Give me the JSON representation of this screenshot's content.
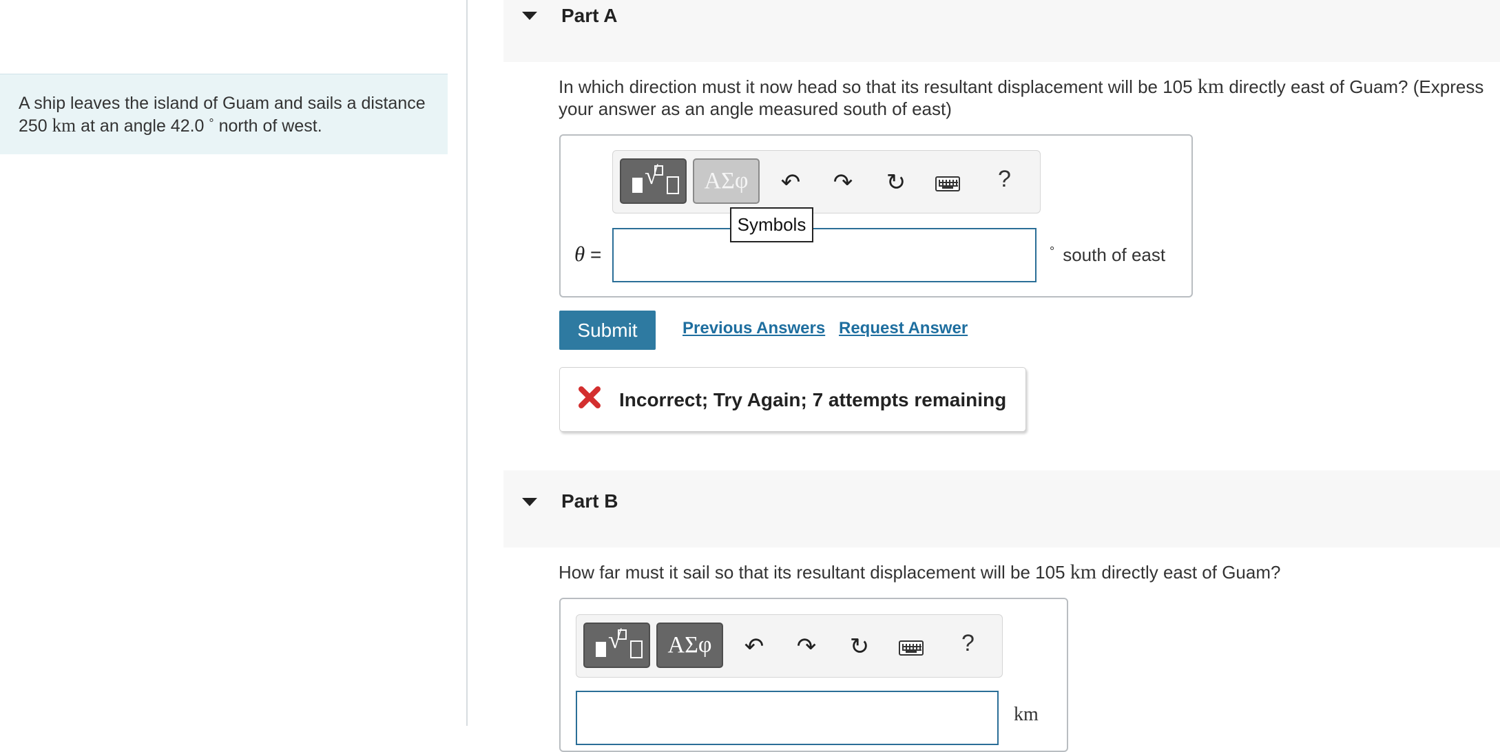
{
  "problem": {
    "text_before": "A ship leaves the island of Guam and sails a distance 250",
    "unit": "km",
    "text_middle": "at an angle 42.0",
    "degree": "°",
    "text_after": "north of west."
  },
  "part_a": {
    "title": "Part A",
    "question_before": "In which direction must it now head so that its resultant displacement will be 105",
    "question_unit": "km",
    "question_line1_end": "directly east of Guam? (Express",
    "question_line2": "your answer as an angle measured south of east)",
    "variable_label": "θ",
    "equals": "=",
    "input_value": "",
    "degree": "°",
    "unit_text": "south of east",
    "toolbar": {
      "templates_icon": "templates-sqrt-icon",
      "symbols_label": "ΑΣφ",
      "undo_icon": "undo-icon",
      "redo_icon": "redo-icon",
      "reset_icon": "reset-icon",
      "keyboard_icon": "keyboard-icon",
      "help_label": "?",
      "tooltip": "Symbols"
    },
    "submit_label": "Submit",
    "previous_answers_label": "Previous Answers",
    "request_answer_label": "Request Answer",
    "feedback": "Incorrect; Try Again; 7 attempts remaining"
  },
  "part_b": {
    "title": "Part B",
    "question_before": "How far must it sail so that its resultant displacement will be 105",
    "question_unit": "km",
    "question_after": "directly east of Guam?",
    "toolbar": {
      "templates_icon": "templates-sqrt-icon",
      "symbols_label": "ΑΣφ",
      "undo_icon": "undo-icon",
      "redo_icon": "redo-icon",
      "reset_icon": "reset-icon",
      "keyboard_icon": "keyboard-icon",
      "help_label": "?"
    },
    "input_value": "",
    "unit_text": "km"
  },
  "colors": {
    "accent": "#2e7aa1",
    "link": "#1e6e9f",
    "error": "#d32f2f",
    "sidebar_bg": "#e9f4f6",
    "header_bg": "#f7f7f7"
  }
}
